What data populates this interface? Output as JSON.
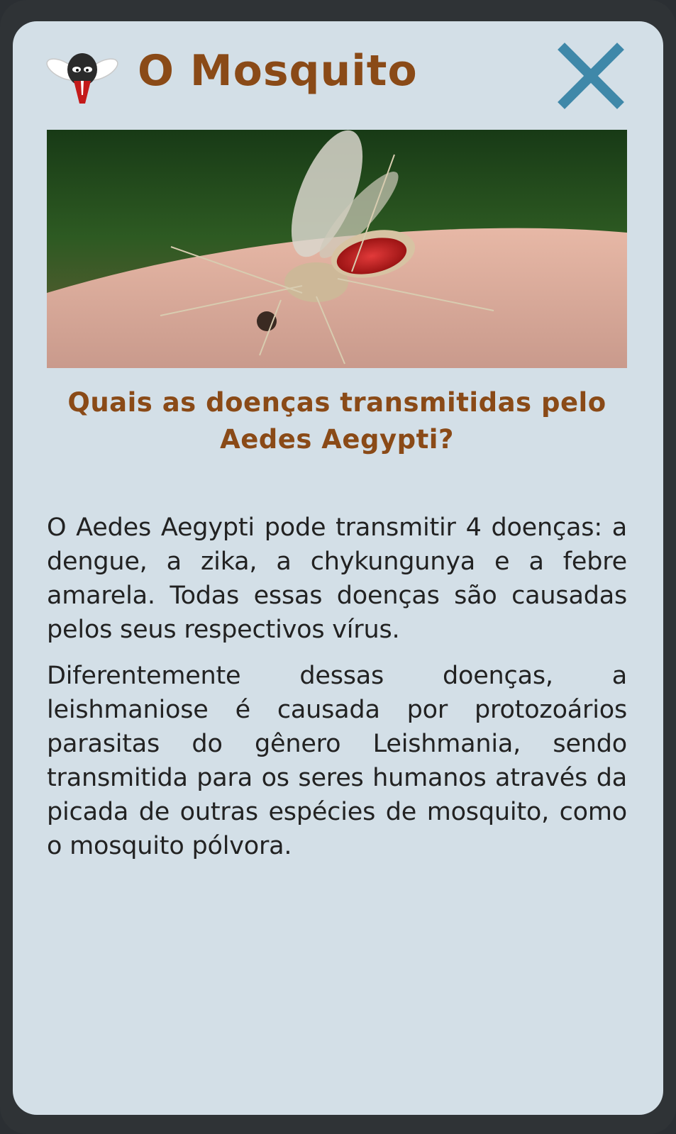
{
  "header": {
    "title": "O Mosquito",
    "logo_icon": "mosquito-mascot-icon",
    "close_icon": "close-x-icon"
  },
  "image": {
    "subject": "mosquito-on-skin-photo"
  },
  "question": "Quais as doenças transmitidas pelo Aedes Aegypti?",
  "paragraphs": [
    "O Aedes Aegypti pode transmitir 4 doenças: a dengue, a zika, a chykungunya e a febre amarela. Todas essas doenças são causadas pelos seus respectivos vírus.",
    "Diferentemente dessas doenças, a leishmaniose é causada por protozoários parasitas do gênero Leishmania, sendo transmitida para os seres humanos através da picada de outras espécies de mosquito, como o mosquito pólvora."
  ],
  "colors": {
    "card_background": "#d3dfe7",
    "frame": "#2f3336",
    "title": "#8a4a17",
    "close": "#3f88a9",
    "body_text": "#222222"
  }
}
